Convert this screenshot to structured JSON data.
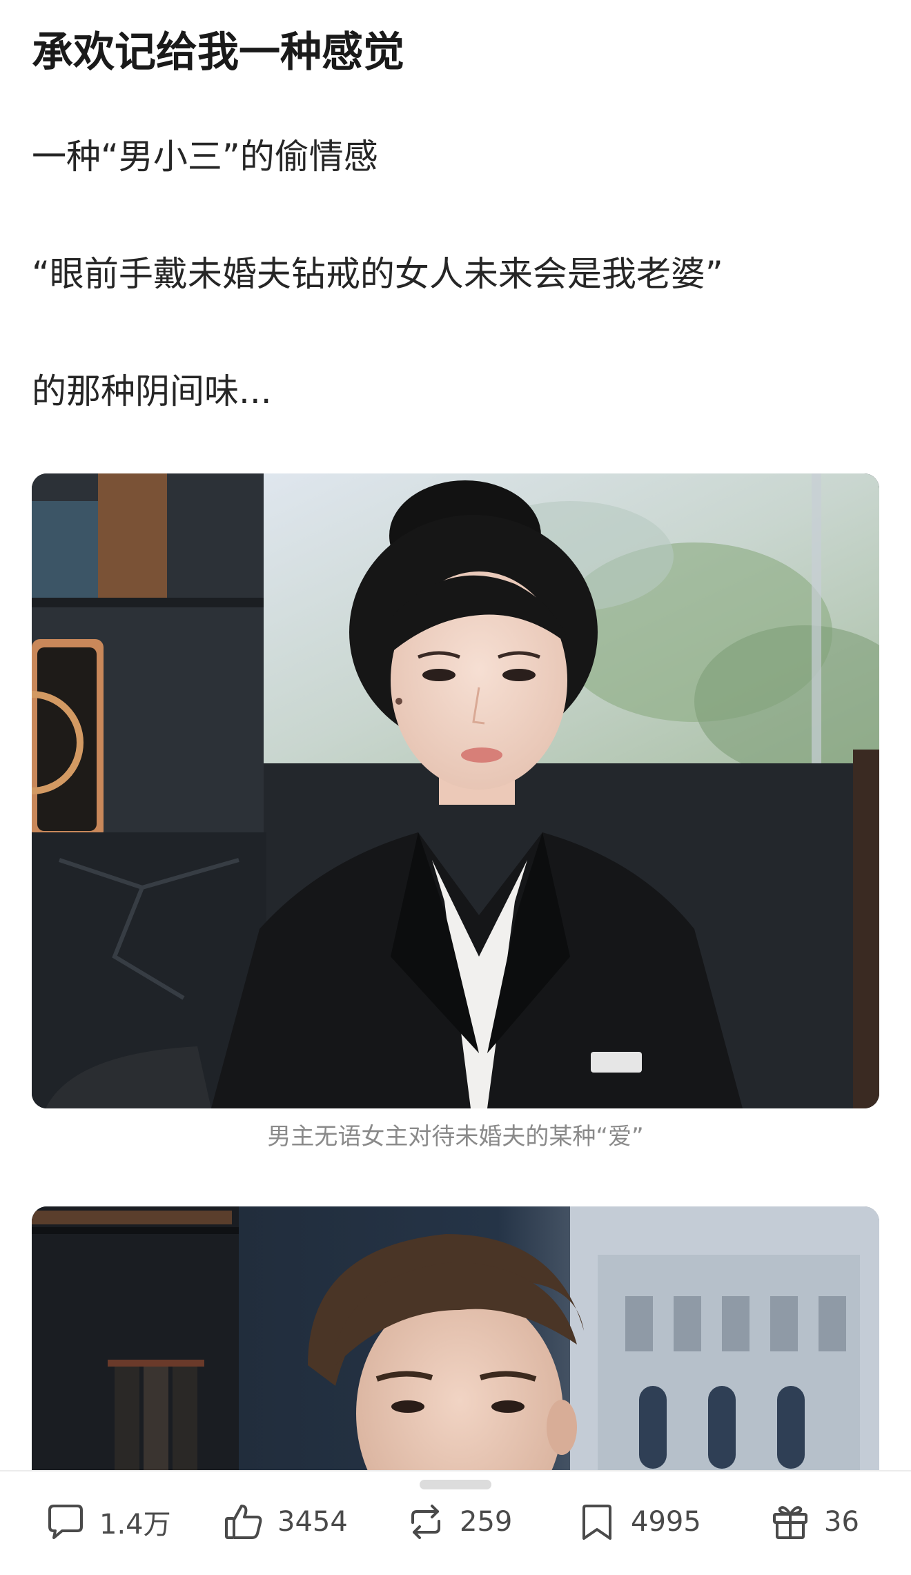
{
  "article": {
    "title": "承欢记给我一种感觉",
    "paragraphs": [
      "一种“男小三”的偷情感",
      "“眼前手戴未婚夫钻戒的女人未来会是我老婆”",
      "的那种阴间味..."
    ],
    "images": [
      {
        "caption": "男主无语女主对待未婚夫的某种“爱”"
      },
      {
        "caption": ""
      }
    ]
  },
  "actions": {
    "comment": {
      "icon": "comment-icon",
      "count": "1.4万"
    },
    "like": {
      "icon": "thumbs-up-icon",
      "count": "3454"
    },
    "repost": {
      "icon": "repost-icon",
      "count": "259"
    },
    "favorite": {
      "icon": "bookmark-icon",
      "count": "4995"
    },
    "gift": {
      "icon": "gift-icon",
      "count": "36"
    }
  },
  "colors": {
    "text": "#1f1f1f",
    "caption": "#8a8a8a",
    "icon": "#4a4a4a",
    "background": "#ffffff"
  }
}
